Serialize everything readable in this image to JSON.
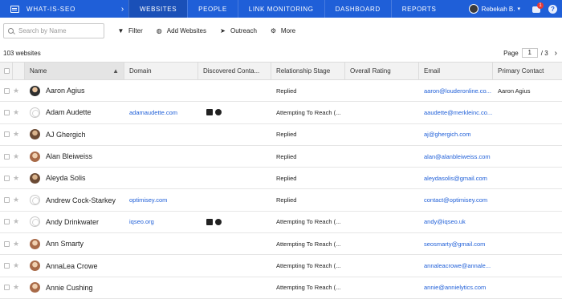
{
  "app": {
    "brand": "WHAT-IS-SEO",
    "nav_tabs": [
      {
        "label": "WEBSITES",
        "active": true
      },
      {
        "label": "PEOPLE",
        "active": false
      },
      {
        "label": "LINK MONITORING",
        "active": false
      },
      {
        "label": "DASHBOARD",
        "active": false
      },
      {
        "label": "REPORTS",
        "active": false
      }
    ],
    "user_name": "Rebekah B.",
    "notification_count": "1",
    "help_label": "?"
  },
  "toolbar": {
    "search_placeholder": "Search by Name",
    "filter_label": "Filter",
    "add_websites_label": "Add Websites",
    "outreach_label": "Outreach",
    "more_label": "More"
  },
  "list": {
    "count_text": "103 websites",
    "page_label": "Page",
    "page_current": "1",
    "page_total": "/ 3"
  },
  "table": {
    "columns": [
      "Name",
      "Domain",
      "Discovered Conta...",
      "Relationship Stage",
      "Overall Rating",
      "Email",
      "Primary Contact"
    ],
    "rows": [
      {
        "name": "Aaron Agius",
        "avatar": "photo2",
        "domain": "",
        "social": [],
        "stage": "Replied",
        "rating": "",
        "email": "aaron@louderonline.co...",
        "contact": "Aaron Agius"
      },
      {
        "name": "Adam Audette",
        "avatar": "globe",
        "domain": "adamaudette.com",
        "social": [
          "twitter-icon",
          "globe-icon"
        ],
        "stage": "Attempting To Reach (...",
        "rating": "",
        "email": "aaudette@merkleinc.co...",
        "contact": ""
      },
      {
        "name": "AJ Ghergich",
        "avatar": "photo",
        "domain": "",
        "social": [],
        "stage": "Replied",
        "rating": "",
        "email": "aj@ghergich.com",
        "contact": ""
      },
      {
        "name": "Alan Bleiweiss",
        "avatar": "photo3",
        "domain": "",
        "social": [],
        "stage": "Replied",
        "rating": "",
        "email": "alan@alanbleiweiss.com",
        "contact": ""
      },
      {
        "name": "Aleyda Solis",
        "avatar": "photo",
        "domain": "",
        "social": [],
        "stage": "Replied",
        "rating": "",
        "email": "aleydasolis@gmail.com",
        "contact": ""
      },
      {
        "name": "Andrew Cock-Starkey",
        "avatar": "globe",
        "domain": "optimisey.com",
        "social": [],
        "stage": "Replied",
        "rating": "",
        "email": "contact@optimisey.com",
        "contact": ""
      },
      {
        "name": "Andy Drinkwater",
        "avatar": "globe",
        "domain": "iqseo.org",
        "social": [
          "google-plus-icon",
          "globe-icon"
        ],
        "stage": "Attempting To Reach (...",
        "rating": "",
        "email": "andy@iqseo.uk",
        "contact": ""
      },
      {
        "name": "Ann Smarty",
        "avatar": "photo3",
        "domain": "",
        "social": [],
        "stage": "Attempting To Reach (...",
        "rating": "",
        "email": "seosmarty@gmail.com",
        "contact": ""
      },
      {
        "name": "AnnaLea Crowe",
        "avatar": "photo3",
        "domain": "",
        "social": [],
        "stage": "Attempting To Reach (...",
        "rating": "",
        "email": "annaleacrowe@annale...",
        "contact": ""
      },
      {
        "name": "Annie Cushing",
        "avatar": "photo3",
        "domain": "",
        "social": [],
        "stage": "Attempting To Reach (...",
        "rating": "",
        "email": "annie@annielytics.com",
        "contact": ""
      }
    ]
  },
  "colors": {
    "nav_bg": "#1f5fd8",
    "link": "#1f5fd8"
  }
}
